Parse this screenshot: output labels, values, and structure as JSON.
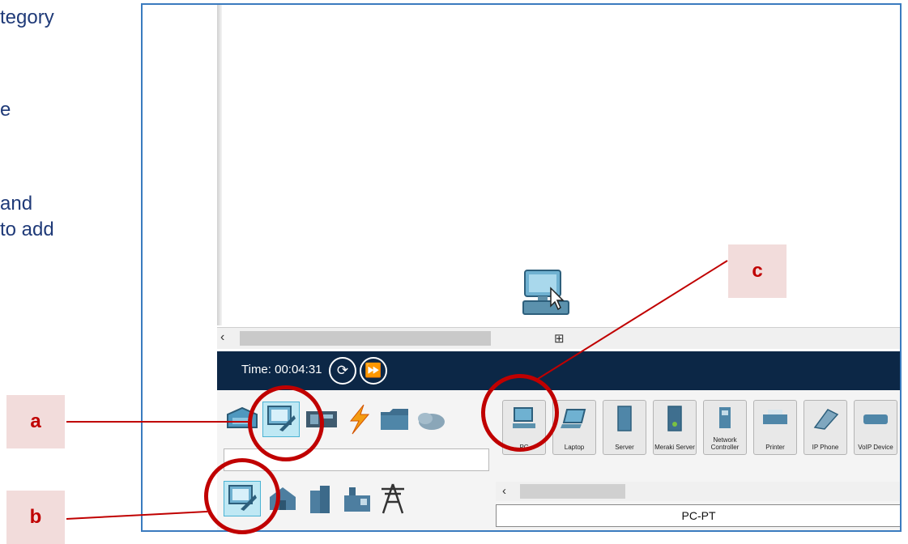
{
  "left_text": {
    "line1": "tegory",
    "line2": "e",
    "line3": "and",
    "line4": "to add"
  },
  "simulation": {
    "time_label": "Time: 00:04:31",
    "reset_icon": "reset-clock-icon",
    "fast_forward_icon": "fast-forward-icon"
  },
  "device_categories": [
    "network-devices",
    "end-devices",
    "components",
    "connections",
    "miscellaneous",
    "multiuser"
  ],
  "end_device_subcategories": [
    "end-devices",
    "home",
    "smart-city",
    "industrial",
    "power-grid"
  ],
  "devices": [
    {
      "label": "PC",
      "icon": "pc-icon"
    },
    {
      "label": "Laptop",
      "icon": "laptop-icon"
    },
    {
      "label": "Server",
      "icon": "server-icon"
    },
    {
      "label": "Meraki Server",
      "icon": "meraki-server-icon"
    },
    {
      "label": "Network Controller",
      "icon": "network-controller-icon"
    },
    {
      "label": "Printer",
      "icon": "printer-icon"
    },
    {
      "label": "IP Phone",
      "icon": "ip-phone-icon"
    },
    {
      "label": "VoIP Device",
      "icon": "voip-device-icon"
    }
  ],
  "model_label": "PC-PT",
  "callouts": {
    "a": "a",
    "b": "b",
    "c": "c"
  },
  "colors": {
    "accent": "#c00000",
    "callout_bg": "#f2dcdb",
    "timebar": "#0c2746",
    "frame": "#3a7bbf",
    "text": "#1f3a78"
  }
}
